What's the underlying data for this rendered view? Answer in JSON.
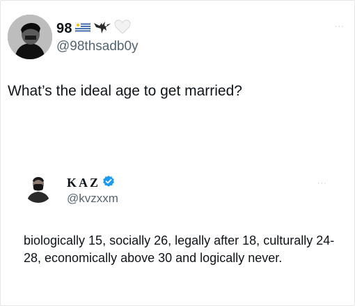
{
  "tweet1": {
    "name": "98",
    "handle": "@98thsadb0y",
    "text": "What’s the ideal age to get married?",
    "more": "···"
  },
  "tweet2": {
    "name": "KAZ",
    "handle": "@kvzxxm",
    "text": "biologically 15, socially 26, legally after 18, culturally 24-28, economically above 30 and logically never.",
    "more": "···"
  },
  "icons": {
    "tw1_name_emojis": [
      "uruguay-flag-icon",
      "eagle-icon",
      "white-heart-icon"
    ],
    "tw2_badge": "verified-badge-icon",
    "verified_color": "#1d9bf0"
  }
}
